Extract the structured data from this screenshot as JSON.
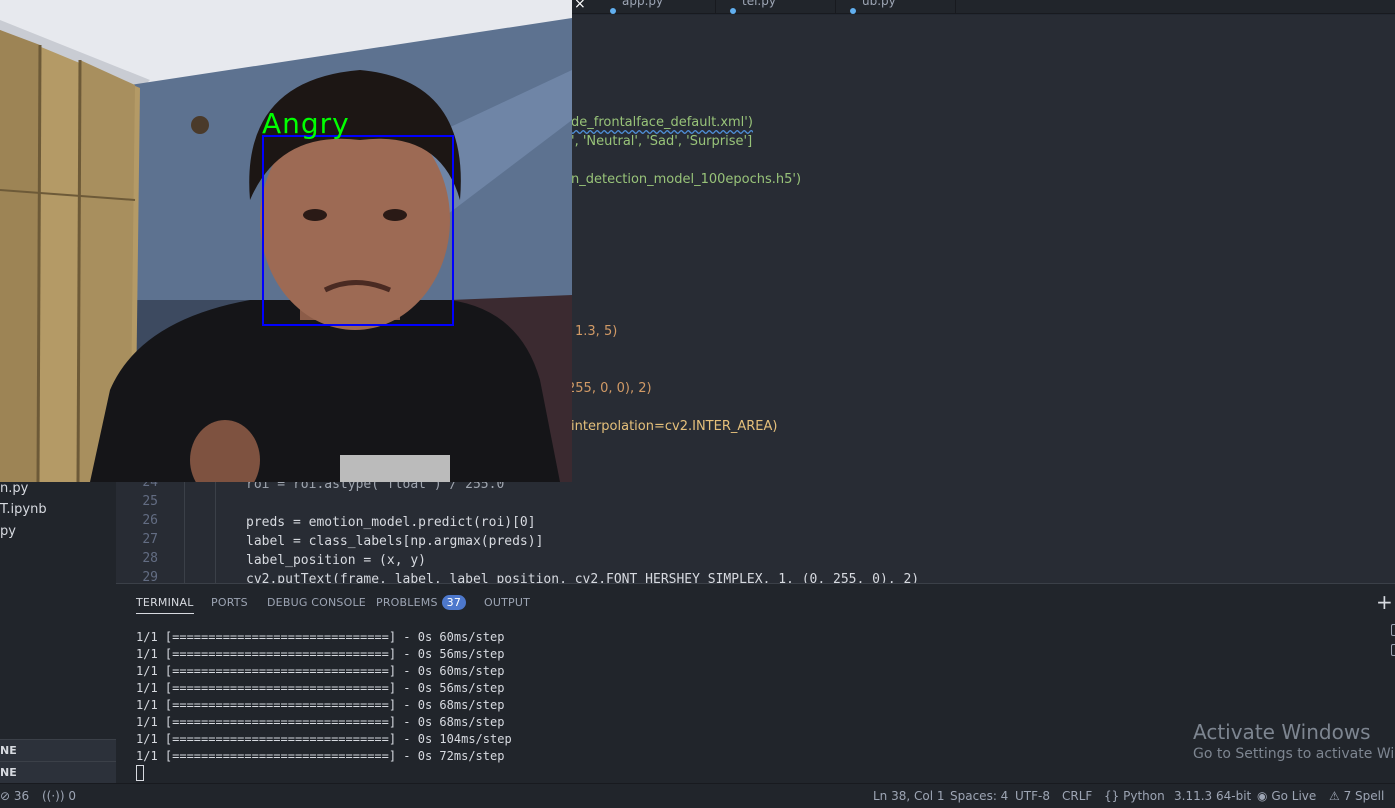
{
  "sidebar": {
    "files": [
      "n.py",
      "T.ipynb",
      "py"
    ],
    "sections": [
      "NE",
      "NE"
    ]
  },
  "tabs": [
    {
      "label": "app.py"
    },
    {
      "label": "tel.py"
    },
    {
      "label": "ub.py"
    }
  ],
  "tab_close_glyph": "×",
  "editor": {
    "partial_lines": [
      {
        "text": "de_frontalface_default.xml')"
      },
      {
        "text": "', 'Neutral', 'Sad', 'Surprise']"
      },
      {
        "text": "n_detection_model_100epochs.h5')"
      },
      {
        "text": "1.3, 5)"
      },
      {
        "text": "255, 0, 0), 2)"
      },
      {
        "text": "interpolation=cv2.INTER_AREA)"
      }
    ],
    "line_numbers": [
      "24",
      "25",
      "26",
      "27",
      "28",
      "29"
    ],
    "lines": [
      {
        "number": "24",
        "text": "roi = roi.astype('float') / 255.0"
      },
      {
        "number": "25",
        "text": ""
      },
      {
        "number": "26",
        "text": "preds = emotion_model.predict(roi)[0]"
      },
      {
        "number": "27",
        "text": "label = class_labels[np.argmax(preds)]"
      },
      {
        "number": "28",
        "text": "label_position = (x, y)"
      },
      {
        "number": "29",
        "text": "cv2.putText(frame, label, label_position, cv2.FONT_HERSHEY_SIMPLEX, 1, (0, 255, 0), 2)"
      }
    ]
  },
  "panel": {
    "tabs": [
      "TERMINAL",
      "PORTS",
      "DEBUG CONSOLE",
      "PROBLEMS",
      "OUTPUT"
    ],
    "problems_count": "37",
    "plus_glyph": "+",
    "terminal_lines": [
      "1/1 [==============================] - 0s 60ms/step",
      "1/1 [==============================] - 0s 56ms/step",
      "1/1 [==============================] - 0s 60ms/step",
      "1/1 [==============================] - 0s 56ms/step",
      "1/1 [==============================] - 0s 68ms/step",
      "1/1 [==============================] - 0s 68ms/step",
      "1/1 [==============================] - 0s 104ms/step",
      "1/1 [==============================] - 0s 72ms/step"
    ]
  },
  "watermark": {
    "title": "Activate Windows",
    "subtitle": "Go to Settings to activate Wind"
  },
  "statusbar": {
    "errors": "36",
    "remote": "0",
    "position": "Ln 38, Col 1",
    "spaces": "Spaces: 4",
    "encoding": "UTF-8",
    "eol": "CRLF",
    "language": "Python",
    "interpreter": "3.11.3 64-bit",
    "golive": "Go Live",
    "spell": "7 Spell"
  },
  "webcam": {
    "emotion_label": "Angry",
    "box_color": "#0000ff",
    "label_color": "#00ff00"
  },
  "colors": {
    "editor_bg": "#282c34",
    "panel_bg": "#21252b",
    "accent": "#4d78cc"
  }
}
